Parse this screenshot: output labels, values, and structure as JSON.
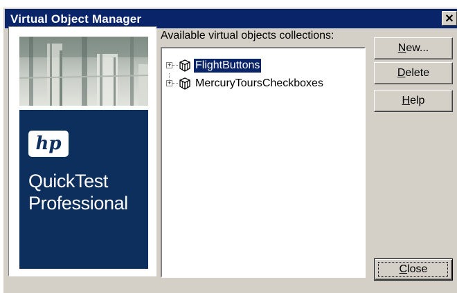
{
  "window": {
    "title": "Virtual Object Manager",
    "close_glyph": "✕"
  },
  "logo": {
    "hp_mark": "hp",
    "product_line1": "QuickTest",
    "product_line2": "Professional"
  },
  "collections": {
    "label": "Available virtual objects collections:",
    "items": [
      {
        "label": "FlightButtons",
        "selected": true,
        "icon": "virtual-object-collection-icon"
      },
      {
        "label": "MercuryToursCheckboxes",
        "selected": false,
        "icon": "virtual-object-collection-icon"
      }
    ]
  },
  "buttons": {
    "new": {
      "mnemonic": "N",
      "rest": "ew..."
    },
    "delete": {
      "mnemonic": "D",
      "rest": "elete"
    },
    "help": {
      "mnemonic": "H",
      "rest": "elp"
    },
    "close": {
      "mnemonic": "C",
      "rest": "lose"
    }
  },
  "colors": {
    "titlebar": "#0a246a",
    "selection": "#0a246a",
    "dialog_face": "#d4d0c8",
    "brand_panel": "#0d2f5e"
  }
}
